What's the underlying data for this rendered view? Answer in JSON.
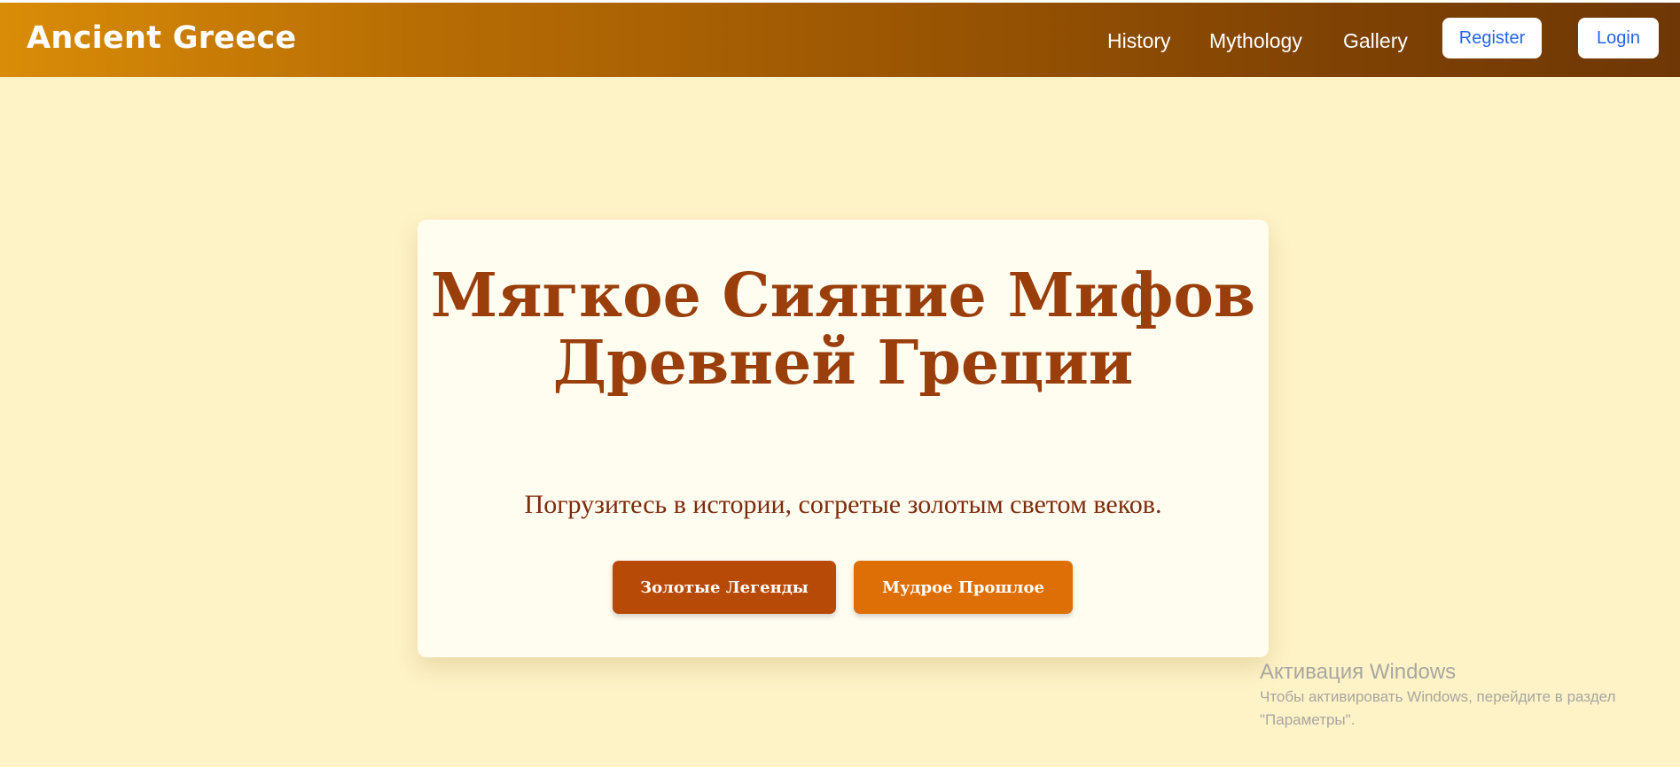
{
  "navbar": {
    "brand": "Ancient Greece",
    "links": [
      "History",
      "Mythology",
      "Gallery"
    ],
    "register_label": "Register",
    "login_label": "Login"
  },
  "hero": {
    "title": "Мягкое Сияние Мифов Древней Греции",
    "subtitle": "Погрузитесь в истории, согретые золотым светом веков.",
    "buttons": [
      "Золотые Легенды",
      "Мудрое Прошлое"
    ]
  },
  "watermark": {
    "title": "Активация Windows",
    "text": "Чтобы активировать Windows, перейдите в раздел \"Параметры\"."
  },
  "colors": {
    "page_background": "#fef3c7",
    "navbar_gradient_start": "#d98c07",
    "navbar_gradient_end": "#6e3705",
    "title": "#9a3f0b",
    "button_primary": "#b84a07",
    "button_secondary": "#de6f06",
    "nav_button_text": "#2563eb"
  }
}
